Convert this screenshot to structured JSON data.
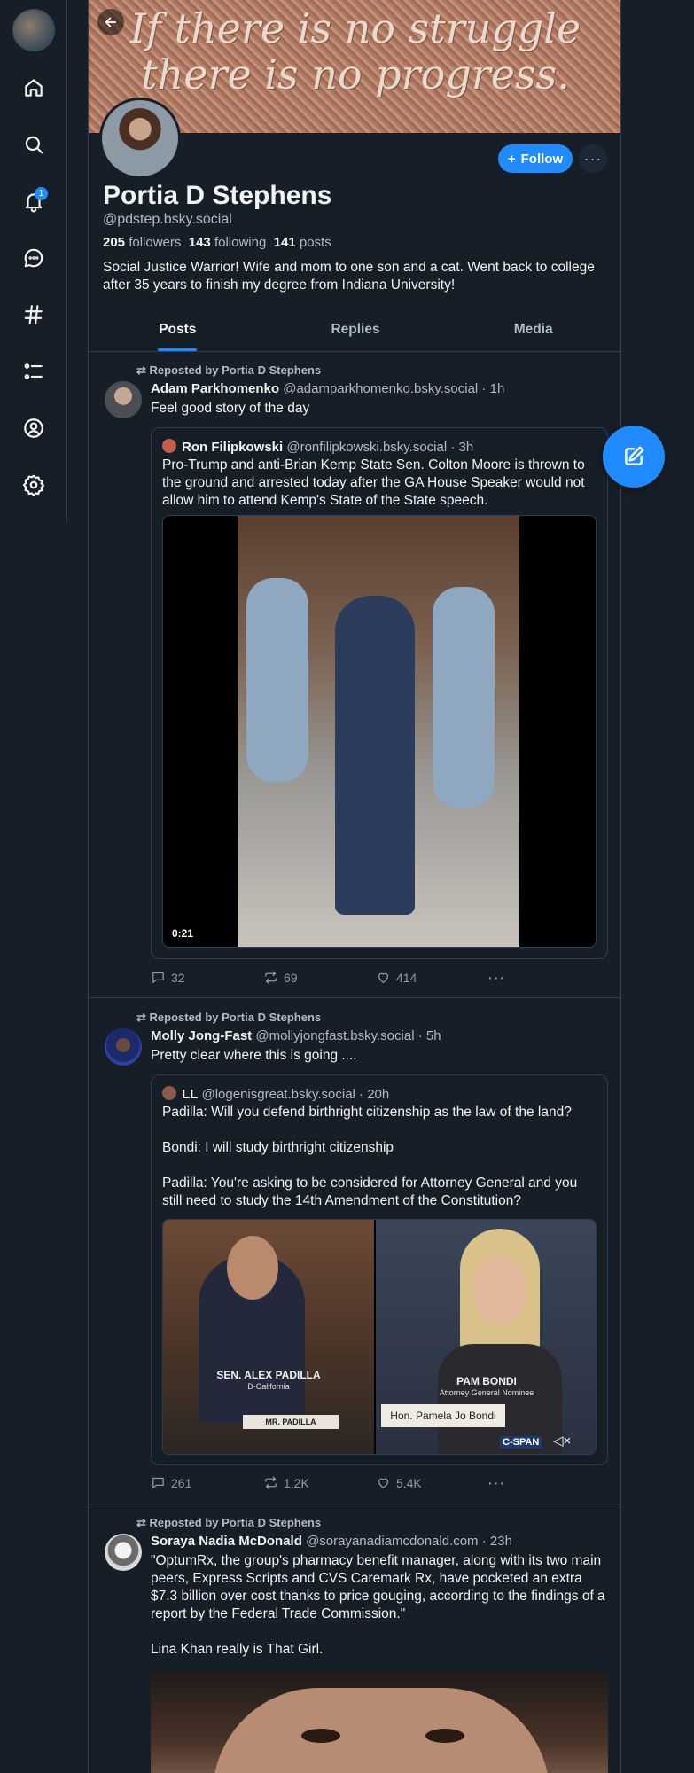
{
  "sidebar": {
    "items": [
      {
        "icon": "home-icon"
      },
      {
        "icon": "search-icon"
      },
      {
        "icon": "bell-icon",
        "badge": "1"
      },
      {
        "icon": "chat-icon"
      },
      {
        "icon": "hashtag-icon"
      },
      {
        "icon": "list-icon"
      },
      {
        "icon": "profile-icon"
      },
      {
        "icon": "settings-icon"
      }
    ]
  },
  "profile": {
    "banner_text": "If there is no struggle\nthere is no progress.",
    "name": "Portia D Stephens",
    "handle": "@pdstep.bsky.social",
    "followers_count": "205",
    "followers_label": "followers",
    "following_count": "143",
    "following_label": "following",
    "posts_count": "141",
    "posts_label": "posts",
    "bio": "Social Justice Warrior! Wife and mom to one son and a cat. Went back to college after 35 years to finish my degree from Indiana University!",
    "follow_label": "Follow"
  },
  "tabs": [
    {
      "label": "Posts",
      "active": true
    },
    {
      "label": "Replies",
      "active": false
    },
    {
      "label": "Media",
      "active": false
    }
  ],
  "posts": [
    {
      "repost_label": "Reposted by Portia D Stephens",
      "author_name": "Adam Parkhomenko",
      "author_handle": "@adamparkhomenko.bsky.social · 1h",
      "text": "Feel good story of the day",
      "quote": {
        "author_name": "Ron Filipkowski",
        "author_handle": "@ronfilipkowski.bsky.social · 3h",
        "text": "Pro-Trump and anti-Brian Kemp State Sen. Colton Moore is thrown to the ground and arrested today after the GA House Speaker would not allow him to attend Kemp's State of the State speech.",
        "video_duration": "0:21"
      },
      "replies": "32",
      "reposts": "69",
      "likes": "414"
    },
    {
      "repost_label": "Reposted by Portia D Stephens",
      "author_name": "Molly Jong-Fast",
      "author_handle": "@mollyjongfast.bsky.social · 5h",
      "text": "Pretty clear where this is going ....",
      "quote": {
        "author_name": "LL",
        "author_handle": "@logenisgreat.bsky.social · 20h",
        "text": "Padilla: Will you defend birthright citizenship as the law of the land?\n\nBondi: I will study birthright citizenship\n\nPadilla: You're asking to be considered for Attorney General and you still need to study the 14th Amendment of the Constitution?",
        "caption_left_name": "SEN. ALEX PADILLA",
        "caption_left_sub": "D-California",
        "nameplate_left": "MR. PADILLA",
        "caption_right_name": "PAM BONDI",
        "caption_right_sub": "Attorney General Nominee",
        "nameplate_right": "Hon. Pamela Jo Bondi",
        "network": "C-SPAN"
      },
      "replies": "261",
      "reposts": "1.2K",
      "likes": "5.4K"
    },
    {
      "repost_label": "Reposted by Portia D Stephens",
      "author_name": "Soraya Nadia McDonald",
      "author_handle": "@sorayanadiamcdonald.com · 23h",
      "text": "\"OptumRx, the group's pharmacy benefit manager, along with its two main peers, Express Scripts and CVS Caremark Rx, have pocketed an extra $7.3 billion over cost thanks to price gouging, according to the findings of a report by the Federal Trade Commission.\"\n\nLina Khan really is That Girl."
    }
  ],
  "colors": {
    "background": "#161e27",
    "accent": "#208bfe",
    "border": "#2e4052",
    "muted_text": "#aebbc9"
  }
}
